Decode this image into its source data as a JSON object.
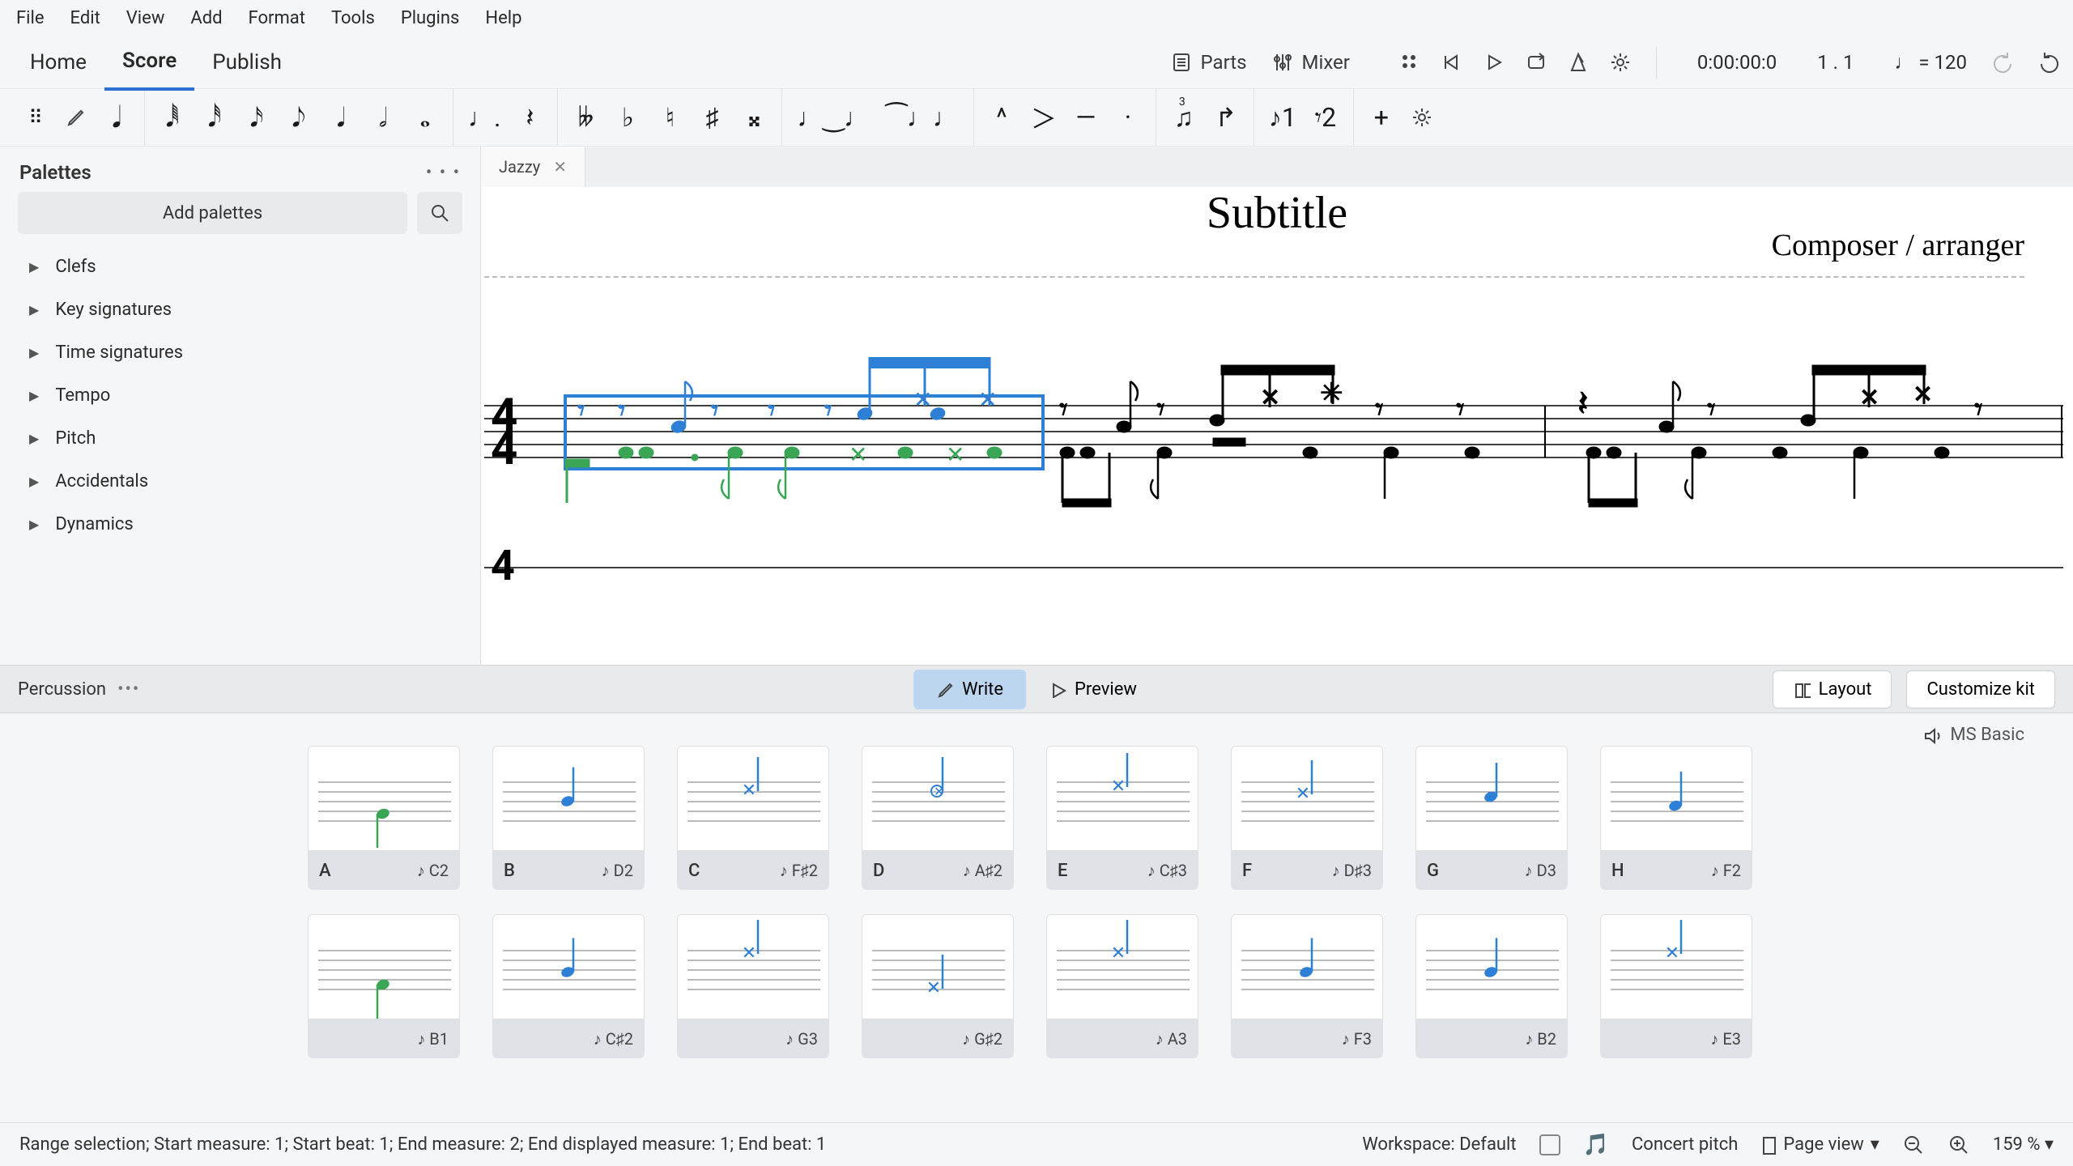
{
  "menu": [
    "File",
    "Edit",
    "View",
    "Add",
    "Format",
    "Tools",
    "Plugins",
    "Help"
  ],
  "tabs": {
    "home": "Home",
    "score": "Score",
    "publish": "Publish"
  },
  "top_right": {
    "parts": "Parts",
    "mixer": "Mixer",
    "time": "0:00:00:0",
    "beat": "1 . 1",
    "tempo": "= 120"
  },
  "sidebar": {
    "title": "Palettes",
    "add": "Add palettes",
    "items": [
      "Clefs",
      "Key signatures",
      "Time signatures",
      "Tempo",
      "Pitch",
      "Accidentals",
      "Dynamics"
    ]
  },
  "score": {
    "tab": "Jazzy",
    "subtitle": "Subtitle",
    "composer": "Composer / arranger"
  },
  "perc": {
    "label": "Percussion",
    "write": "Write",
    "preview": "Preview",
    "layout": "Layout",
    "customize": "Customize kit",
    "sound": "MS Basic"
  },
  "pads_row1": [
    {
      "key": "A",
      "note": "♪ C2",
      "color": "green",
      "pos": 78
    },
    {
      "key": "B",
      "note": "♪ D2",
      "color": "blue",
      "pos": 47
    },
    {
      "key": "C",
      "note": "♪ F♯2",
      "color": "blue",
      "pos": 22,
      "cross": true
    },
    {
      "key": "D",
      "note": "♪ A♯2",
      "color": "blue",
      "pos": 22,
      "circ": true
    },
    {
      "key": "E",
      "note": "♪ C♯3",
      "color": "blue",
      "pos": 12,
      "cross": true
    },
    {
      "key": "F",
      "note": "♪ D♯3",
      "color": "blue",
      "pos": 30,
      "cross": true
    },
    {
      "key": "G",
      "note": "♪ D3",
      "color": "blue",
      "pos": 36
    },
    {
      "key": "H",
      "note": "♪ F2",
      "color": "blue",
      "pos": 58
    }
  ],
  "pads_row2": [
    {
      "key": "",
      "note": "♪ B1",
      "color": "green",
      "pos": 84
    },
    {
      "key": "",
      "note": "♪ C♯2",
      "color": "blue",
      "pos": 53
    },
    {
      "key": "",
      "note": "♪ G3",
      "color": "blue",
      "pos": 8,
      "cross": true
    },
    {
      "key": "",
      "note": "♪ G♯2",
      "color": "blue",
      "pos": 94,
      "cross": true,
      "green": true
    },
    {
      "key": "",
      "note": "♪ A3",
      "color": "blue",
      "pos": 8,
      "cross": true
    },
    {
      "key": "",
      "note": "♪ F3",
      "color": "blue",
      "pos": 53
    },
    {
      "key": "",
      "note": "♪ B2",
      "color": "blue",
      "pos": 53
    },
    {
      "key": "",
      "note": "♪ E3",
      "color": "blue",
      "pos": 8,
      "cross": true
    }
  ],
  "status": {
    "left": "Range selection; Start measure: 1; Start beat: 1; End measure: 2; End displayed measure: 1; End beat: 1",
    "workspace": "Workspace: Default",
    "concert": "Concert pitch",
    "view": "Page view",
    "zoom": "159 %"
  }
}
